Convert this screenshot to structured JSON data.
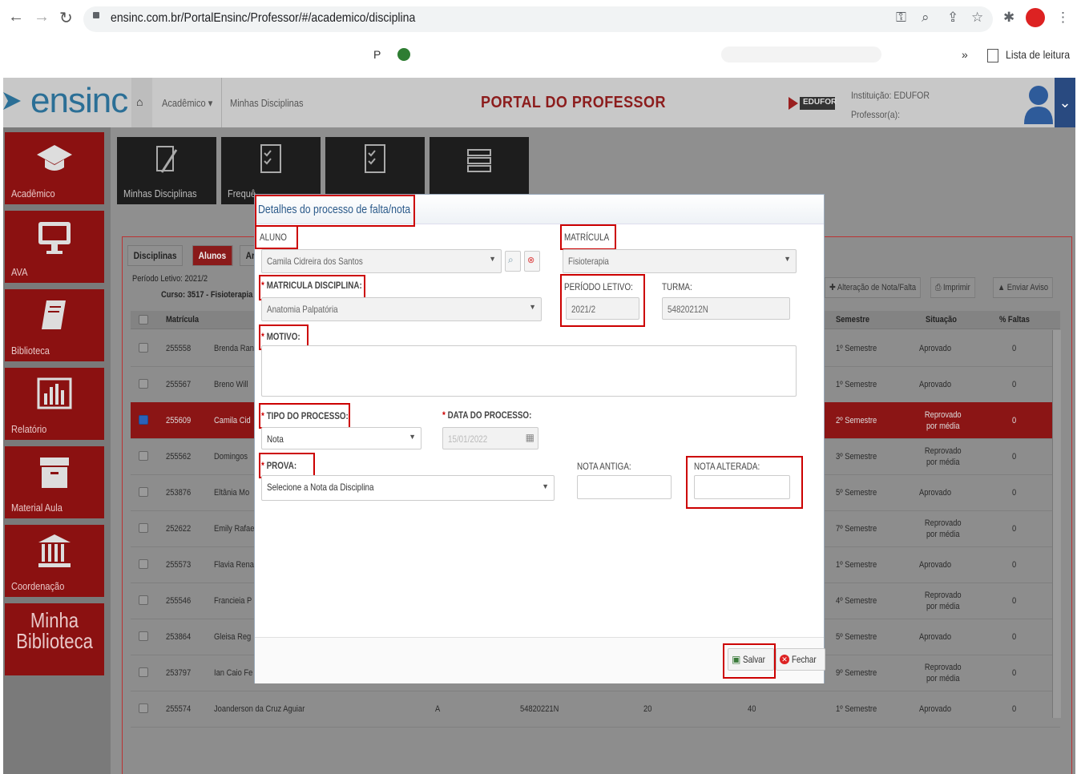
{
  "browser": {
    "url": "ensinc.com.br/PortalEnsinc/Professor/#/academico/disciplina",
    "bookmark_p": "P",
    "overflow": "»",
    "reading_list": "Lista de leitura"
  },
  "header": {
    "logo": "ensinc",
    "menu_academico": "Acadêmico ▾",
    "menu_minhas": "Minhas Disciplinas",
    "portal_title": "PORTAL DO PROFESSOR",
    "institution": "Instituição: EDUFOR",
    "professor": "Professor(a):",
    "edufor_logo": "EDUFOR"
  },
  "sidebar": {
    "items": [
      {
        "label": "Acadêmico",
        "icon": "graduation-cap-icon"
      },
      {
        "label": "AVA",
        "icon": "monitor-icon"
      },
      {
        "label": "Biblioteca",
        "icon": "book-icon"
      },
      {
        "label": "Relatório",
        "icon": "bar-chart-icon"
      },
      {
        "label": "Material Aula",
        "icon": "archive-icon"
      },
      {
        "label": "Coordenação",
        "icon": "building-icon"
      }
    ],
    "minha_biblioteca_1": "Minha",
    "minha_biblioteca_2": "Biblioteca"
  },
  "tiles": [
    {
      "label": "Minhas Disciplinas"
    },
    {
      "label": "Frequê"
    },
    {
      "label": ""
    },
    {
      "label": ""
    }
  ],
  "panel": {
    "tabs": [
      "Disciplinas",
      "Alunos",
      "Arquivos"
    ],
    "periodo": "Período Letivo: 2021/2",
    "curso": "Curso: 3517 - Fisioterapia",
    "btn_alteracao": "Alteração de Nota/Falta",
    "btn_imprimir": "Imprimir",
    "btn_aviso": "Enviar Aviso",
    "col_matricula": "Matrícula",
    "col_semestre": "Semestre",
    "col_situacao": "Situação",
    "col_faltas": "% Faltas",
    "rows": [
      {
        "mat": "255558",
        "nome": "Brenda Ran",
        "sem": "1º Semestre",
        "sit": "Aprovado",
        "f": "0",
        "sel": false
      },
      {
        "mat": "255567",
        "nome": "Breno Will",
        "sem": "1º Semestre",
        "sit": "Aprovado",
        "f": "0",
        "sel": false
      },
      {
        "mat": "255609",
        "nome": "Camila Cid",
        "sem": "2º Semestre",
        "sit": "Reprovado por média",
        "f": "0",
        "sel": true
      },
      {
        "mat": "255562",
        "nome": "Domingos",
        "sem": "3º Semestre",
        "sit": "Reprovado por média",
        "f": "0",
        "sel": false
      },
      {
        "mat": "253876",
        "nome": "Eltânia Mo",
        "sem": "5º Semestre",
        "sit": "Aprovado",
        "f": "0",
        "sel": false
      },
      {
        "mat": "252622",
        "nome": "Emily Rafae",
        "sem": "7º Semestre",
        "sit": "Reprovado por média",
        "f": "0",
        "sel": false
      },
      {
        "mat": "255573",
        "nome": "Flavia Rena",
        "sem": "1º Semestre",
        "sit": "Aprovado",
        "f": "0",
        "sel": false
      },
      {
        "mat": "255546",
        "nome": "Francieia P",
        "sem": "4º Semestre",
        "sit": "Reprovado por média",
        "f": "0",
        "sel": false
      },
      {
        "mat": "253864",
        "nome": "Gleisa Reg",
        "sem": "5º Semestre",
        "sit": "Aprovado",
        "f": "0",
        "sel": false
      },
      {
        "mat": "253797",
        "nome": "Ian Caio Fe",
        "sem": "9º Semestre",
        "sit": "Reprovado por média",
        "f": "0",
        "sel": false
      },
      {
        "mat": "255574",
        "nome": "Joanderson da Cruz Aguiar",
        "turma": "A",
        "cod": "54820221N",
        "n1": "20",
        "n2": "40",
        "sem": "1º Semestre",
        "sit": "Aprovado",
        "f": "0",
        "sel": false
      }
    ]
  },
  "modal": {
    "title": "Detalhes do processo de falta/nota",
    "aluno_label": "ALUNO",
    "aluno_value": "Camila Cidreira dos Santos",
    "matricula_label": "MATRÍCULA",
    "matricula_value": "Fisioterapia",
    "mat_disc_label": "MATRICULA DISCIPLINA:",
    "mat_disc_value": "Anatomia Palpatória",
    "periodo_label": "PERÍODO LETIVO:",
    "periodo_value": "2021/2",
    "turma_label": "TURMA:",
    "turma_value": "54820212N",
    "motivo_label": "MOTIVO:",
    "tipo_label": "TIPO DO PROCESSO:",
    "tipo_value": "Nota",
    "data_label": "DATA DO PROCESSO:",
    "data_value": "15/01/2022",
    "prova_label": "PROVA:",
    "prova_value": "Selecione a Nota da Disciplina",
    "nota_antiga_label": "NOTA ANTIGA:",
    "nota_alterada_label": "NOTA ALTERADA:",
    "salvar": "Salvar",
    "fechar": "Fechar",
    "req": "*"
  }
}
